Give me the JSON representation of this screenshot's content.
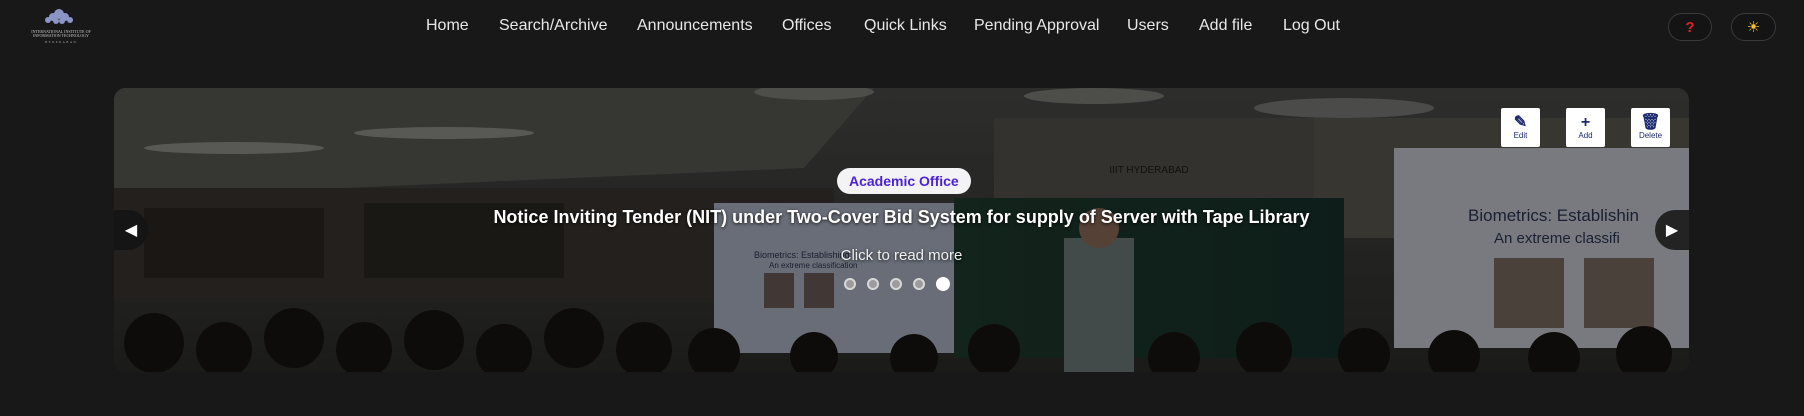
{
  "logo": {
    "text_line1": "INTERNATIONAL INSTITUTE OF",
    "text_line2": "INFORMATION TECHNOLOGY",
    "text_line3": "HYDERABAD"
  },
  "nav": {
    "items": [
      {
        "label": "Home"
      },
      {
        "label": "Search/Archive"
      },
      {
        "label": "Announcements"
      },
      {
        "label": "Offices"
      },
      {
        "label": "Quick Links"
      },
      {
        "label": "Pending Approval"
      },
      {
        "label": "Users"
      },
      {
        "label": "Add file"
      },
      {
        "label": "Log Out"
      }
    ],
    "help_label": "?",
    "theme_label": "☀"
  },
  "carousel": {
    "tools": {
      "edit_label": "Edit",
      "add_label": "Add",
      "delete_label": "Delete"
    },
    "office_badge": "Academic Office",
    "headline": "Notice Inviting Tender (NIT) under Two-Cover Bid System for supply of Server with Tape Library",
    "read_more": "Click to read more",
    "slide_count": 5,
    "active_slide": 5,
    "prev_label": "◀",
    "next_label": "▶",
    "scene_texts": {
      "building_sign": "IIIT HYDERABAD",
      "screen_left_title": "Biometrics: Establishing",
      "screen_left_sub": "An extreme classification",
      "screen_right_title": "Biometrics: Establishin",
      "screen_right_sub": "An extreme classifi"
    }
  },
  "colors": {
    "background": "#181818",
    "badge_text": "#4b22d6",
    "help_icon": "#e0202a",
    "theme_icon": "#f5c430"
  }
}
